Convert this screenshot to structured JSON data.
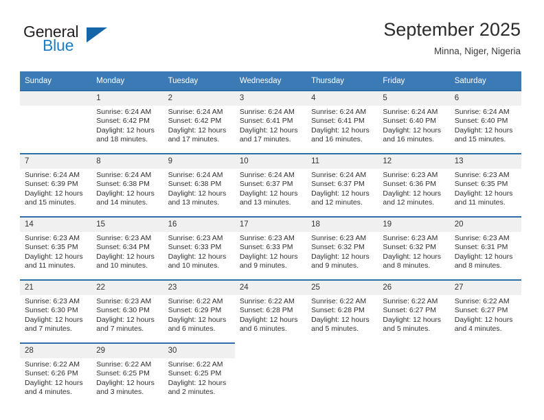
{
  "brand": {
    "name_part1": "General",
    "name_part2": "Blue",
    "triangle_color": "#1466a8",
    "blue_color": "#1d7ec4"
  },
  "header": {
    "title": "September 2025",
    "location": "Minna, Niger, Nigeria"
  },
  "theme": {
    "header_blue": "#3c7ab6",
    "row_border_blue": "#2d6ca8",
    "day_band_gray": "#f0f0f0"
  },
  "weekdays": [
    "Sunday",
    "Monday",
    "Tuesday",
    "Wednesday",
    "Thursday",
    "Friday",
    "Saturday"
  ],
  "labels": {
    "sunrise_prefix": "Sunrise: ",
    "sunset_prefix": "Sunset: ",
    "daylight_prefix": "Daylight: "
  },
  "weeks": [
    [
      {
        "day": "",
        "blank": true
      },
      {
        "day": "1",
        "sunrise": "Sunrise: 6:24 AM",
        "sunset": "Sunset: 6:42 PM",
        "daylight_l1": "Daylight: 12 hours",
        "daylight_l2": "and 18 minutes."
      },
      {
        "day": "2",
        "sunrise": "Sunrise: 6:24 AM",
        "sunset": "Sunset: 6:42 PM",
        "daylight_l1": "Daylight: 12 hours",
        "daylight_l2": "and 17 minutes."
      },
      {
        "day": "3",
        "sunrise": "Sunrise: 6:24 AM",
        "sunset": "Sunset: 6:41 PM",
        "daylight_l1": "Daylight: 12 hours",
        "daylight_l2": "and 17 minutes."
      },
      {
        "day": "4",
        "sunrise": "Sunrise: 6:24 AM",
        "sunset": "Sunset: 6:41 PM",
        "daylight_l1": "Daylight: 12 hours",
        "daylight_l2": "and 16 minutes."
      },
      {
        "day": "5",
        "sunrise": "Sunrise: 6:24 AM",
        "sunset": "Sunset: 6:40 PM",
        "daylight_l1": "Daylight: 12 hours",
        "daylight_l2": "and 16 minutes."
      },
      {
        "day": "6",
        "sunrise": "Sunrise: 6:24 AM",
        "sunset": "Sunset: 6:40 PM",
        "daylight_l1": "Daylight: 12 hours",
        "daylight_l2": "and 15 minutes."
      }
    ],
    [
      {
        "day": "7",
        "sunrise": "Sunrise: 6:24 AM",
        "sunset": "Sunset: 6:39 PM",
        "daylight_l1": "Daylight: 12 hours",
        "daylight_l2": "and 15 minutes."
      },
      {
        "day": "8",
        "sunrise": "Sunrise: 6:24 AM",
        "sunset": "Sunset: 6:38 PM",
        "daylight_l1": "Daylight: 12 hours",
        "daylight_l2": "and 14 minutes."
      },
      {
        "day": "9",
        "sunrise": "Sunrise: 6:24 AM",
        "sunset": "Sunset: 6:38 PM",
        "daylight_l1": "Daylight: 12 hours",
        "daylight_l2": "and 13 minutes."
      },
      {
        "day": "10",
        "sunrise": "Sunrise: 6:24 AM",
        "sunset": "Sunset: 6:37 PM",
        "daylight_l1": "Daylight: 12 hours",
        "daylight_l2": "and 13 minutes."
      },
      {
        "day": "11",
        "sunrise": "Sunrise: 6:24 AM",
        "sunset": "Sunset: 6:37 PM",
        "daylight_l1": "Daylight: 12 hours",
        "daylight_l2": "and 12 minutes."
      },
      {
        "day": "12",
        "sunrise": "Sunrise: 6:23 AM",
        "sunset": "Sunset: 6:36 PM",
        "daylight_l1": "Daylight: 12 hours",
        "daylight_l2": "and 12 minutes."
      },
      {
        "day": "13",
        "sunrise": "Sunrise: 6:23 AM",
        "sunset": "Sunset: 6:35 PM",
        "daylight_l1": "Daylight: 12 hours",
        "daylight_l2": "and 11 minutes."
      }
    ],
    [
      {
        "day": "14",
        "sunrise": "Sunrise: 6:23 AM",
        "sunset": "Sunset: 6:35 PM",
        "daylight_l1": "Daylight: 12 hours",
        "daylight_l2": "and 11 minutes."
      },
      {
        "day": "15",
        "sunrise": "Sunrise: 6:23 AM",
        "sunset": "Sunset: 6:34 PM",
        "daylight_l1": "Daylight: 12 hours",
        "daylight_l2": "and 10 minutes."
      },
      {
        "day": "16",
        "sunrise": "Sunrise: 6:23 AM",
        "sunset": "Sunset: 6:33 PM",
        "daylight_l1": "Daylight: 12 hours",
        "daylight_l2": "and 10 minutes."
      },
      {
        "day": "17",
        "sunrise": "Sunrise: 6:23 AM",
        "sunset": "Sunset: 6:33 PM",
        "daylight_l1": "Daylight: 12 hours",
        "daylight_l2": "and 9 minutes."
      },
      {
        "day": "18",
        "sunrise": "Sunrise: 6:23 AM",
        "sunset": "Sunset: 6:32 PM",
        "daylight_l1": "Daylight: 12 hours",
        "daylight_l2": "and 9 minutes."
      },
      {
        "day": "19",
        "sunrise": "Sunrise: 6:23 AM",
        "sunset": "Sunset: 6:32 PM",
        "daylight_l1": "Daylight: 12 hours",
        "daylight_l2": "and 8 minutes."
      },
      {
        "day": "20",
        "sunrise": "Sunrise: 6:23 AM",
        "sunset": "Sunset: 6:31 PM",
        "daylight_l1": "Daylight: 12 hours",
        "daylight_l2": "and 8 minutes."
      }
    ],
    [
      {
        "day": "21",
        "sunrise": "Sunrise: 6:23 AM",
        "sunset": "Sunset: 6:30 PM",
        "daylight_l1": "Daylight: 12 hours",
        "daylight_l2": "and 7 minutes."
      },
      {
        "day": "22",
        "sunrise": "Sunrise: 6:23 AM",
        "sunset": "Sunset: 6:30 PM",
        "daylight_l1": "Daylight: 12 hours",
        "daylight_l2": "and 7 minutes."
      },
      {
        "day": "23",
        "sunrise": "Sunrise: 6:22 AM",
        "sunset": "Sunset: 6:29 PM",
        "daylight_l1": "Daylight: 12 hours",
        "daylight_l2": "and 6 minutes."
      },
      {
        "day": "24",
        "sunrise": "Sunrise: 6:22 AM",
        "sunset": "Sunset: 6:28 PM",
        "daylight_l1": "Daylight: 12 hours",
        "daylight_l2": "and 6 minutes."
      },
      {
        "day": "25",
        "sunrise": "Sunrise: 6:22 AM",
        "sunset": "Sunset: 6:28 PM",
        "daylight_l1": "Daylight: 12 hours",
        "daylight_l2": "and 5 minutes."
      },
      {
        "day": "26",
        "sunrise": "Sunrise: 6:22 AM",
        "sunset": "Sunset: 6:27 PM",
        "daylight_l1": "Daylight: 12 hours",
        "daylight_l2": "and 5 minutes."
      },
      {
        "day": "27",
        "sunrise": "Sunrise: 6:22 AM",
        "sunset": "Sunset: 6:27 PM",
        "daylight_l1": "Daylight: 12 hours",
        "daylight_l2": "and 4 minutes."
      }
    ],
    [
      {
        "day": "28",
        "sunrise": "Sunrise: 6:22 AM",
        "sunset": "Sunset: 6:26 PM",
        "daylight_l1": "Daylight: 12 hours",
        "daylight_l2": "and 4 minutes."
      },
      {
        "day": "29",
        "sunrise": "Sunrise: 6:22 AM",
        "sunset": "Sunset: 6:25 PM",
        "daylight_l1": "Daylight: 12 hours",
        "daylight_l2": "and 3 minutes."
      },
      {
        "day": "30",
        "sunrise": "Sunrise: 6:22 AM",
        "sunset": "Sunset: 6:25 PM",
        "daylight_l1": "Daylight: 12 hours",
        "daylight_l2": "and 2 minutes."
      },
      {
        "day": "",
        "blank": true,
        "noborder": true
      },
      {
        "day": "",
        "blank": true,
        "noborder": true
      },
      {
        "day": "",
        "blank": true,
        "noborder": true
      },
      {
        "day": "",
        "blank": true,
        "noborder": true
      }
    ]
  ]
}
